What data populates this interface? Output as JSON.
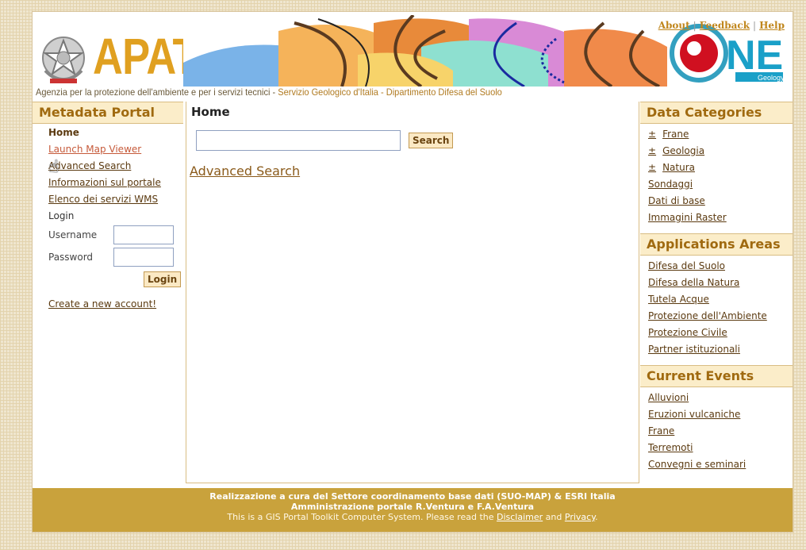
{
  "header": {
    "logo_text": "APAT",
    "tagline_main": "Agenzia per la protezione dell'ambiente e per i servizi tecnici",
    "tagline_sep": " - ",
    "tagline_dept": "Servizio Geologico d'Italia - Dipartimento Difesa del Suolo",
    "links": [
      "About",
      "Feedback",
      "Help"
    ],
    "right_logo_text": "NE",
    "right_logo_sub": "Geology"
  },
  "left": {
    "title": "Metadata Portal",
    "menu": [
      "Home",
      "Launch Map Viewer",
      "Advanced Search",
      "Informazioni sul portale",
      "Elenco dei servizi WMS"
    ],
    "login_label": "Login",
    "username_label": "Username",
    "password_label": "Password",
    "login_button": "Login",
    "create_account": "Create a new account!"
  },
  "center": {
    "title": "Home",
    "search_value": "",
    "search_button": "Search",
    "advanced_link": "Advanced Search"
  },
  "right": {
    "data_categories_title": "Data Categories",
    "data_categories": [
      {
        "label": "Frane",
        "expandable": true
      },
      {
        "label": "Geologia",
        "expandable": true
      },
      {
        "label": "Natura",
        "expandable": true
      },
      {
        "label": "Sondaggi",
        "expandable": false
      },
      {
        "label": "Dati di base",
        "expandable": false
      },
      {
        "label": "Immagini Raster",
        "expandable": false
      }
    ],
    "expand_glyph": "±",
    "applications_title": "Applications Areas",
    "applications": [
      "Difesa del Suolo",
      "Difesa della Natura",
      "Tutela Acque",
      "Protezione dell'Ambiente",
      "Protezione Civile",
      "Partner istituzionali"
    ],
    "events_title": "Current Events",
    "events": [
      "Alluvioni",
      "Eruzioni vulcaniche",
      "Frane",
      "Terremoti",
      "Convegni e seminari"
    ]
  },
  "footer": {
    "line1": "Realizzazione a cura del Settore coordinamento base dati (SUO-MAP) & ESRI Italia",
    "line2": "Amministrazione portale R.Ventura e F.A.Ventura",
    "line3_prefix": "This is a GIS Portal Toolkit Computer System. Please read the",
    "disclaimer": "Disclaimer",
    "and": "and",
    "privacy": "Privacy",
    "suffix": "."
  },
  "colors": {
    "accent": "#a06a10",
    "footer_bg": "#c9a23c",
    "section_bg": "#fbedc9",
    "logo_orange": "#e0a020"
  }
}
